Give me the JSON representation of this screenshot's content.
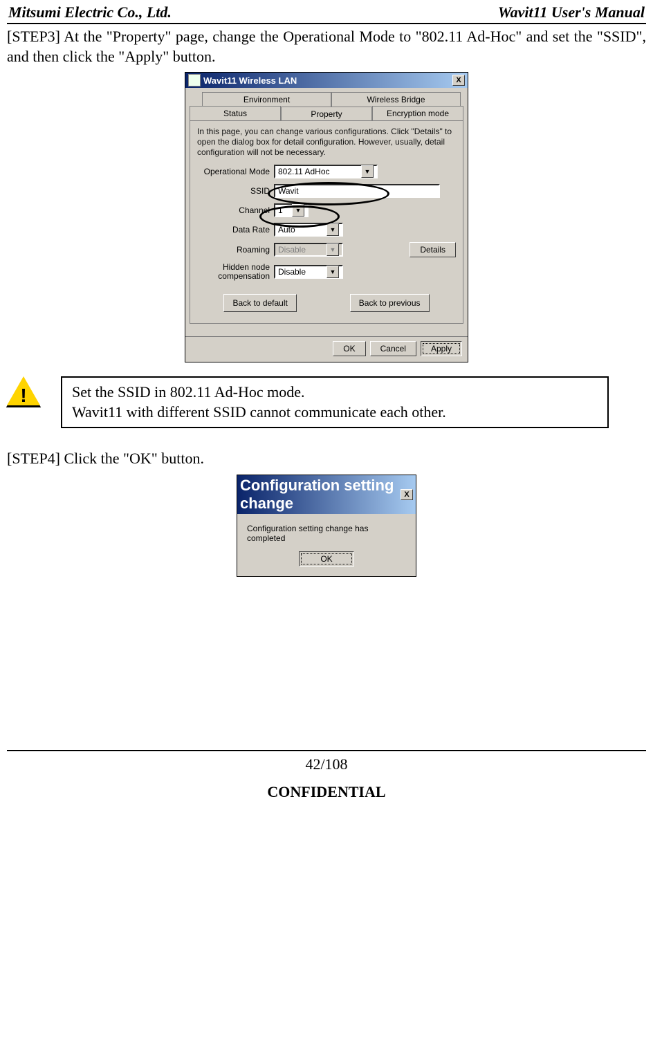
{
  "header": {
    "left": "Mitsumi Electric Co., Ltd.",
    "right": "Wavit11 User's Manual"
  },
  "step3_text": "[STEP3] At the \"Property\" page, change the Operational Mode to \"802.11 Ad-Hoc\" and set the \"SSID\", and then click the \"Apply\" button.",
  "dialog1": {
    "title": "Wavit11 Wireless LAN",
    "close": "X",
    "tabs_row1": [
      "Environment",
      "Wireless Bridge"
    ],
    "tabs_row2": [
      "Status",
      "Property",
      "Encryption mode"
    ],
    "desc": "In this page, you can change various configurations. Click \"Details\" to open the dialog box for detail configuration. However, usually, detail configuration will not be necessary.",
    "labels": {
      "op_mode": "Operational Mode",
      "ssid": "SSID",
      "channel": "Channel",
      "data_rate": "Data Rate",
      "roaming": "Roaming",
      "hidden": "Hidden node compensation"
    },
    "values": {
      "op_mode": "802.11 AdHoc",
      "ssid": "Wavit",
      "channel": "1",
      "data_rate": "Auto",
      "roaming": "Disable",
      "hidden": "Disable"
    },
    "buttons": {
      "details": "Details",
      "back_default": "Back to default",
      "back_previous": "Back to previous",
      "ok": "OK",
      "cancel": "Cancel",
      "apply": "Apply"
    }
  },
  "note": {
    "line1": "Set the SSID in 802.11 Ad-Hoc mode.",
    "line2": "Wavit11 with different SSID cannot communicate each other."
  },
  "step4_text": "[STEP4] Click the \"OK\" button.",
  "dialog2": {
    "title": "Configuration setting change",
    "msg": "Configuration setting change has completed",
    "ok": "OK"
  },
  "footer": {
    "page_num": "42/108",
    "conf": "CONFIDENTIAL"
  }
}
